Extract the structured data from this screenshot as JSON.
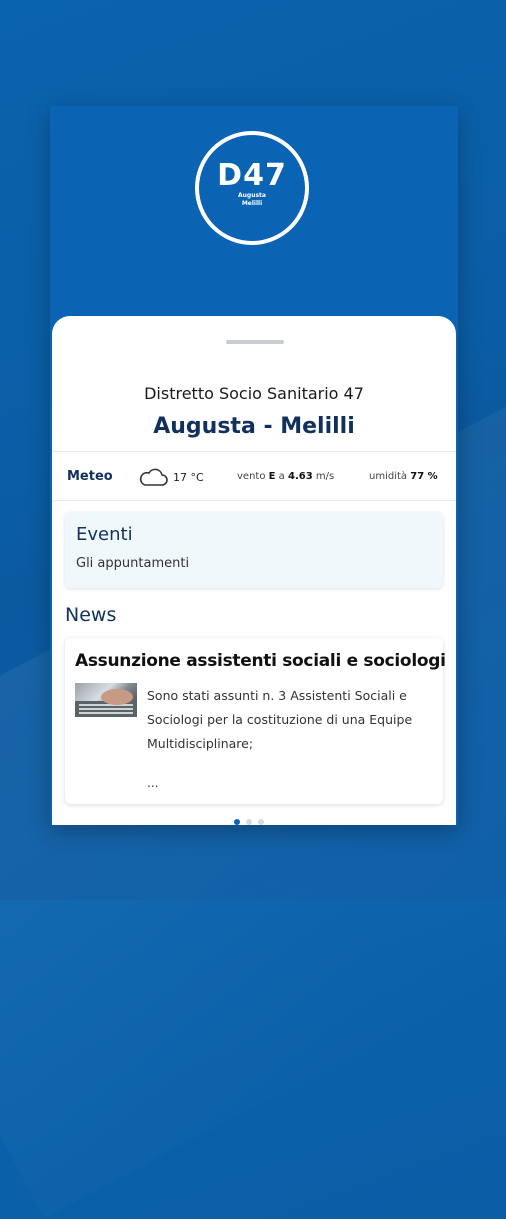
{
  "header": {
    "logo_code": "D47",
    "logo_line1": "Augusta",
    "logo_line2": "Melilli"
  },
  "district": {
    "subtitle": "Distretto Socio Sanitario 47",
    "city": "Augusta - Melilli"
  },
  "meteo": {
    "label": "Meteo",
    "icon": "cloud-icon",
    "temperature": "17 °C",
    "wind_prefix": "vento",
    "wind_direction": "E",
    "wind_connector": "a",
    "wind_speed": "4.63",
    "wind_unit": "m/s",
    "humidity_label": "umidità",
    "humidity_value": "77 %"
  },
  "events": {
    "title": "Eventi",
    "subtitle": "Gli appuntamenti"
  },
  "news": {
    "heading": "News",
    "items": [
      {
        "title": "Assunzione assistenti sociali e sociologi",
        "thumb_icon": "keyboard-photo",
        "text": "Sono stati assunti n. 3 Assistenti Sociali e Sociologi per la costituzione di una Equipe Multidisciplinare;",
        "ellipsis": "..."
      }
    ]
  },
  "pager": {
    "count": 3,
    "active": 1
  },
  "colors": {
    "brand_blue": "#0b63b4",
    "title_navy": "#12305d"
  }
}
